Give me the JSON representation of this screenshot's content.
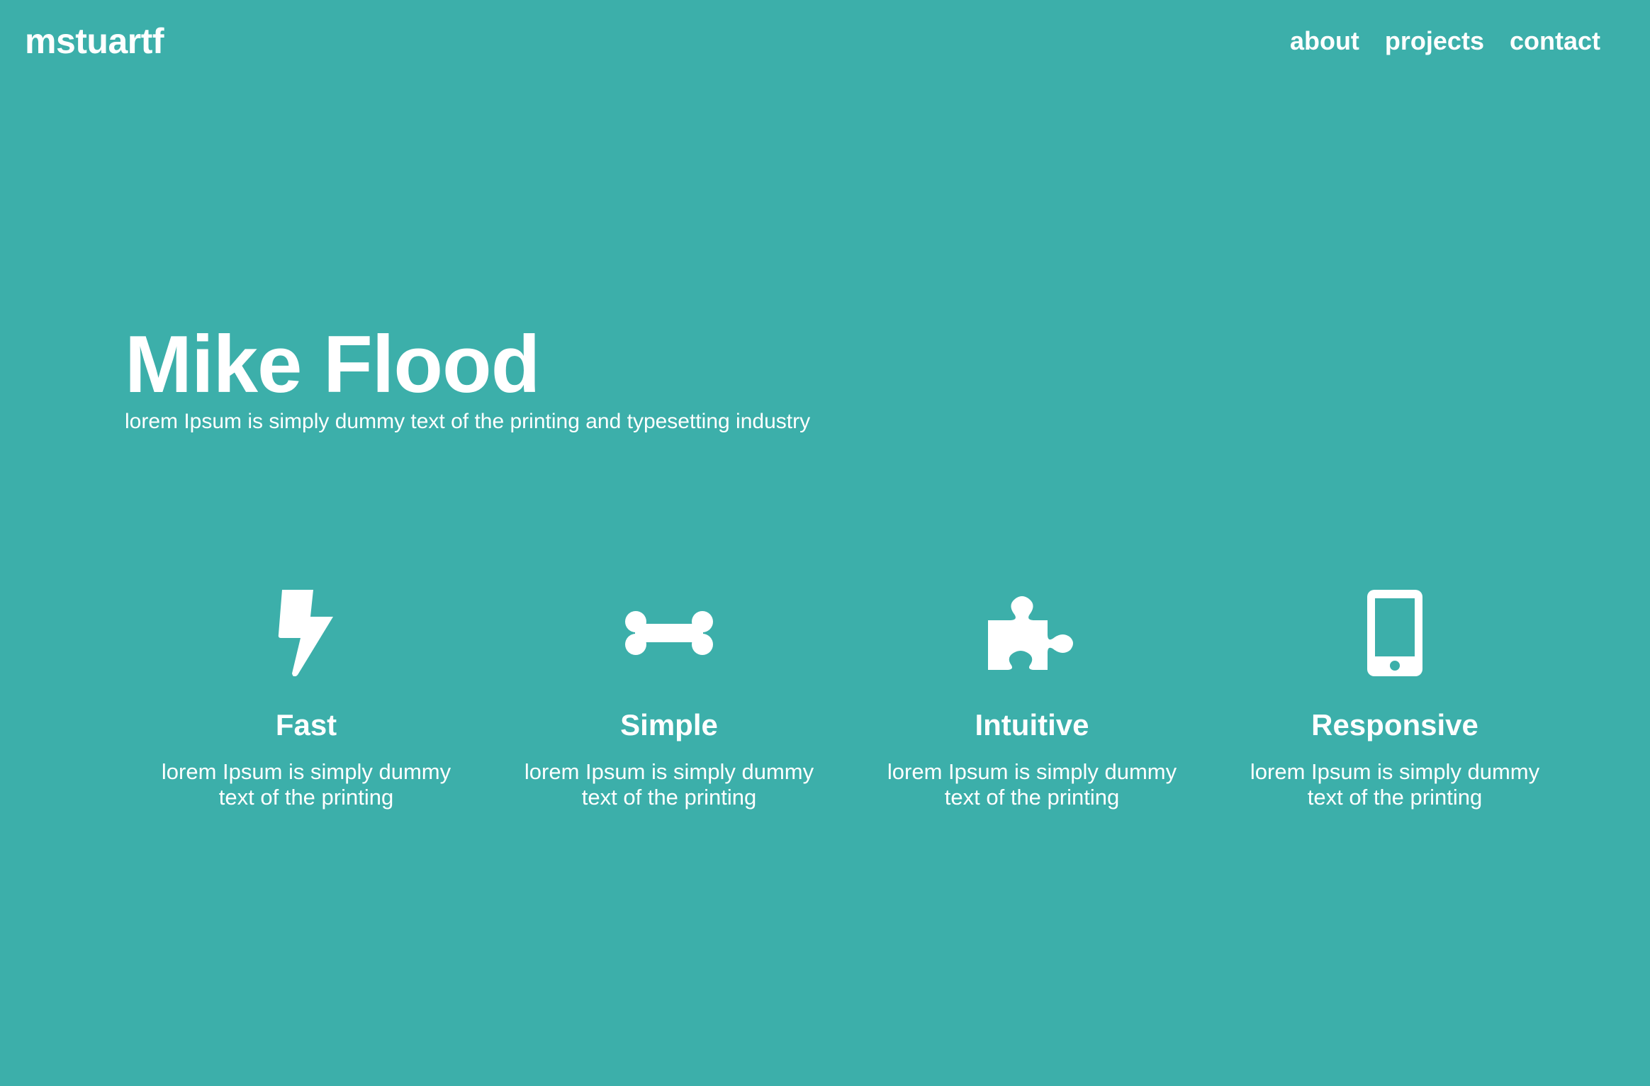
{
  "header": {
    "logo": "mstuartf",
    "nav": [
      {
        "label": "about"
      },
      {
        "label": "projects"
      },
      {
        "label": "contact"
      }
    ]
  },
  "hero": {
    "title": "Mike Flood",
    "subtitle": "lorem Ipsum is simply dummy text of the printing and typesetting industry"
  },
  "features": [
    {
      "icon": "lightning-bolt-icon",
      "title": "Fast",
      "text": "lorem Ipsum is simply dummy text of the printing"
    },
    {
      "icon": "bone-icon",
      "title": "Simple",
      "text": "lorem Ipsum is simply dummy text of the printing"
    },
    {
      "icon": "puzzle-piece-icon",
      "title": "Intuitive",
      "text": "lorem Ipsum is simply dummy text of the printing"
    },
    {
      "icon": "mobile-phone-icon",
      "title": "Responsive",
      "text": "lorem Ipsum is simply dummy text of the printing"
    }
  ],
  "colors": {
    "background": "#3cafaa",
    "foreground": "#ffffff"
  }
}
